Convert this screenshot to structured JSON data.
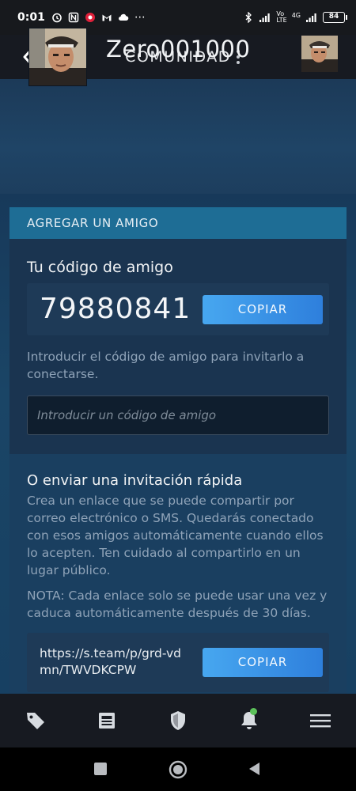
{
  "status_bar": {
    "time": "0:01",
    "battery": "84",
    "network_label_top": "Vo",
    "network_label_bottom": "LTE",
    "signal_label": "4G"
  },
  "header": {
    "title": "COMUNIDAD"
  },
  "profile": {
    "username": "Zero001000"
  },
  "add_friend": {
    "section_title": "AGREGAR UN AMIGO",
    "code_label": "Tu código de amigo",
    "friend_code": "79880841",
    "copy_label": "COPIAR",
    "hint": "Introducir el código de amigo para invitarlo a conectarse.",
    "input_placeholder": "Introducir un código de amigo"
  },
  "quick_invite": {
    "title": "O enviar una invitación rápida",
    "description": "Crea un enlace que se puede compartir por correo electrónico o SMS. Quedarás conectado con esos amigos automáticamente cuando ellos lo acepten. Ten cuidado al compartirlo en un lugar público.",
    "note": "NOTA: Cada enlace solo se puede usar una vez y caduca automáticamente después de 30 días.",
    "link": "https://s.team/p/grd-vdmn/TWVDKCPW",
    "copy_label": "COPIAR"
  },
  "bottom_nav": {
    "items": [
      "tag-icon",
      "news-icon",
      "shield-icon",
      "bell-icon",
      "menu-icon"
    ]
  },
  "colors": {
    "accent": "#3a93e8",
    "section_header": "#1e6d95",
    "notification": "#5cc15a"
  }
}
